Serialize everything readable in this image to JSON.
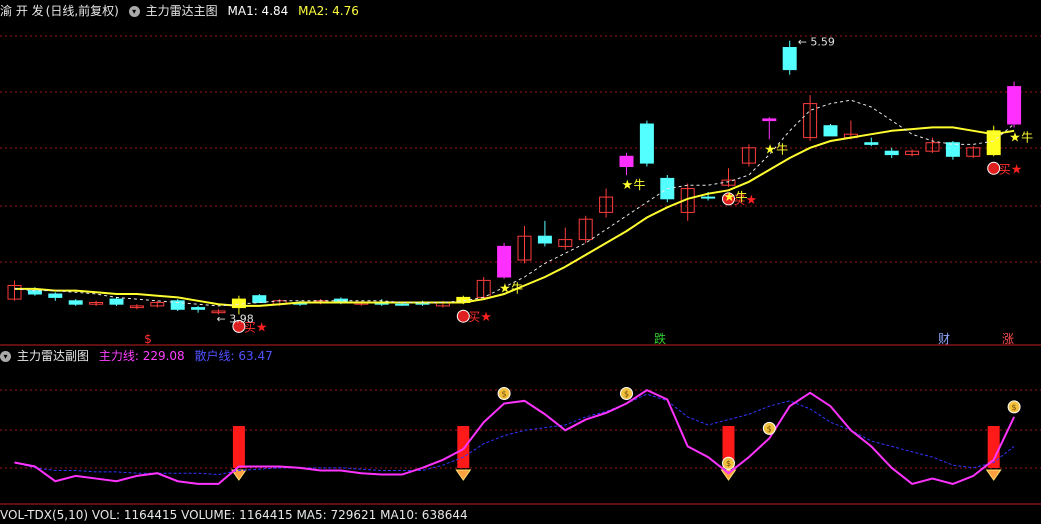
{
  "header": {
    "stock_name": "渝 开 发",
    "period_label": "(日线,前复权)",
    "indicator_name": "主力雷达主图",
    "ma1_label": "MA1: 4.84",
    "ma2_label": "MA2: 4.76"
  },
  "sub_header": {
    "indicator_name": "主力雷达副图",
    "main_line_label": "主力线: 229.08",
    "retail_line_label": "散户线: 63.47"
  },
  "vol_header": {
    "text": "VOL-TDX(5,10) VOL: 1164415 VOLUME: 1164415 MA5: 729621 MA10: 638644"
  },
  "annotations": {
    "high_label": "5.59",
    "low_label": "← 3.98",
    "buy_label": "买",
    "bull_label": "牛",
    "star": "★"
  },
  "event_markers": [
    {
      "label": "$",
      "color": "#ff3030"
    },
    {
      "label": "跌",
      "color": "#30d030"
    },
    {
      "label": "财",
      "color": "#8fa8ff"
    },
    {
      "label": "涨",
      "color": "#ff5050"
    }
  ],
  "colors": {
    "up_candle": "#ff3c3c",
    "down_candle": "#54ffff",
    "big_up_candle": "#ff30ff",
    "ma_line": "#ffff30",
    "grid": "#a01818",
    "main_line": "#ff33ff",
    "retail_line": "#3333ff",
    "signal_bar": "#ff1a1a"
  },
  "chart_data": {
    "type": "candlestick",
    "y_range": [
      3.9,
      5.7
    ],
    "candles": [
      {
        "o": 4.15,
        "h": 4.18,
        "l": 4.06,
        "c": 4.07,
        "ma": 4.13,
        "k": "up"
      },
      {
        "o": 4.12,
        "h": 4.14,
        "l": 4.09,
        "c": 4.1,
        "ma": 4.13,
        "k": "down"
      },
      {
        "o": 4.1,
        "h": 4.11,
        "l": 4.06,
        "c": 4.08,
        "ma": 4.12,
        "k": "down"
      },
      {
        "o": 4.06,
        "h": 4.07,
        "l": 4.03,
        "c": 4.04,
        "ma": 4.12,
        "k": "down"
      },
      {
        "o": 4.05,
        "h": 4.06,
        "l": 4.03,
        "c": 4.04,
        "ma": 4.11,
        "k": "up"
      },
      {
        "o": 4.07,
        "h": 4.08,
        "l": 4.03,
        "c": 4.04,
        "ma": 4.1,
        "k": "down"
      },
      {
        "o": 4.03,
        "h": 4.04,
        "l": 4.01,
        "c": 4.02,
        "ma": 4.1,
        "k": "up"
      },
      {
        "o": 4.05,
        "h": 4.06,
        "l": 4.02,
        "c": 4.03,
        "ma": 4.09,
        "k": "up"
      },
      {
        "o": 4.06,
        "h": 4.07,
        "l": 4.0,
        "c": 4.01,
        "ma": 4.08,
        "k": "down"
      },
      {
        "o": 4.02,
        "h": 4.03,
        "l": 3.99,
        "c": 4.01,
        "ma": 4.06,
        "k": "down"
      },
      {
        "o": 4.0,
        "h": 4.01,
        "l": 3.98,
        "c": 3.99,
        "ma": 4.04,
        "k": "up"
      },
      {
        "o": 4.02,
        "h": 4.09,
        "l": 3.98,
        "c": 4.07,
        "ma": 4.03,
        "k": "yellow"
      },
      {
        "o": 4.09,
        "h": 4.1,
        "l": 4.05,
        "c": 4.05,
        "ma": 4.03,
        "k": "down"
      },
      {
        "o": 4.04,
        "h": 4.07,
        "l": 4.03,
        "c": 4.06,
        "ma": 4.04,
        "k": "up"
      },
      {
        "o": 4.05,
        "h": 4.06,
        "l": 4.03,
        "c": 4.04,
        "ma": 4.05,
        "k": "down"
      },
      {
        "o": 4.06,
        "h": 4.07,
        "l": 4.04,
        "c": 4.05,
        "ma": 4.05,
        "k": "up"
      },
      {
        "o": 4.07,
        "h": 4.08,
        "l": 4.04,
        "c": 4.05,
        "ma": 4.05,
        "k": "down"
      },
      {
        "o": 4.04,
        "h": 4.06,
        "l": 4.03,
        "c": 4.05,
        "ma": 4.05,
        "k": "up"
      },
      {
        "o": 4.05,
        "h": 4.07,
        "l": 4.03,
        "c": 4.04,
        "ma": 4.05,
        "k": "down"
      },
      {
        "o": 4.04,
        "h": 4.05,
        "l": 4.03,
        "c": 4.04,
        "ma": 4.05,
        "k": "down"
      },
      {
        "o": 4.05,
        "h": 4.06,
        "l": 4.03,
        "c": 4.04,
        "ma": 4.05,
        "k": "down"
      },
      {
        "o": 4.03,
        "h": 4.06,
        "l": 4.02,
        "c": 4.05,
        "ma": 4.05,
        "k": "up"
      },
      {
        "o": 4.05,
        "h": 4.09,
        "l": 4.04,
        "c": 4.08,
        "ma": 4.05,
        "k": "yellow"
      },
      {
        "o": 4.08,
        "h": 4.2,
        "l": 4.07,
        "c": 4.18,
        "ma": 4.07,
        "k": "up"
      },
      {
        "o": 4.2,
        "h": 4.4,
        "l": 4.19,
        "c": 4.38,
        "ma": 4.1,
        "k": "magenta"
      },
      {
        "o": 4.3,
        "h": 4.5,
        "l": 4.28,
        "c": 4.44,
        "ma": 4.15,
        "k": "up"
      },
      {
        "o": 4.44,
        "h": 4.53,
        "l": 4.38,
        "c": 4.4,
        "ma": 4.2,
        "k": "down"
      },
      {
        "o": 4.38,
        "h": 4.49,
        "l": 4.36,
        "c": 4.42,
        "ma": 4.26,
        "k": "up"
      },
      {
        "o": 4.42,
        "h": 4.56,
        "l": 4.4,
        "c": 4.54,
        "ma": 4.33,
        "k": "up"
      },
      {
        "o": 4.58,
        "h": 4.72,
        "l": 4.55,
        "c": 4.67,
        "ma": 4.4,
        "k": "up"
      },
      {
        "o": 4.85,
        "h": 4.93,
        "l": 4.8,
        "c": 4.91,
        "ma": 4.47,
        "k": "magenta"
      },
      {
        "o": 5.1,
        "h": 5.12,
        "l": 4.85,
        "c": 4.87,
        "ma": 4.55,
        "k": "down"
      },
      {
        "o": 4.78,
        "h": 4.8,
        "l": 4.64,
        "c": 4.66,
        "ma": 4.61,
        "k": "down"
      },
      {
        "o": 4.58,
        "h": 4.75,
        "l": 4.53,
        "c": 4.72,
        "ma": 4.66,
        "k": "up"
      },
      {
        "o": 4.67,
        "h": 4.7,
        "l": 4.65,
        "c": 4.67,
        "ma": 4.69,
        "k": "down"
      },
      {
        "o": 4.77,
        "h": 4.84,
        "l": 4.73,
        "c": 4.74,
        "ma": 4.71,
        "k": "up"
      },
      {
        "o": 4.87,
        "h": 4.98,
        "l": 4.85,
        "c": 4.96,
        "ma": 4.76,
        "k": "up"
      },
      {
        "o": 5.12,
        "h": 5.14,
        "l": 5.01,
        "c": 5.13,
        "ma": 4.83,
        "k": "magenta"
      },
      {
        "o": 5.55,
        "h": 5.59,
        "l": 5.39,
        "c": 5.42,
        "ma": 4.9,
        "k": "down"
      },
      {
        "o": 5.02,
        "h": 5.27,
        "l": 5.0,
        "c": 5.22,
        "ma": 4.96,
        "k": "up"
      },
      {
        "o": 5.09,
        "h": 5.1,
        "l": 5.03,
        "c": 5.03,
        "ma": 5.0,
        "k": "down"
      },
      {
        "o": 5.02,
        "h": 5.12,
        "l": 5.01,
        "c": 5.04,
        "ma": 5.02,
        "k": "up"
      },
      {
        "o": 4.99,
        "h": 5.02,
        "l": 4.97,
        "c": 4.98,
        "ma": 5.04,
        "k": "down"
      },
      {
        "o": 4.94,
        "h": 4.96,
        "l": 4.9,
        "c": 4.92,
        "ma": 5.06,
        "k": "down"
      },
      {
        "o": 4.92,
        "h": 4.95,
        "l": 4.91,
        "c": 4.94,
        "ma": 5.07,
        "k": "up"
      },
      {
        "o": 4.94,
        "h": 5.02,
        "l": 4.93,
        "c": 4.99,
        "ma": 5.08,
        "k": "up"
      },
      {
        "o": 4.99,
        "h": 5.0,
        "l": 4.89,
        "c": 4.91,
        "ma": 5.08,
        "k": "down"
      },
      {
        "o": 4.91,
        "h": 4.97,
        "l": 4.9,
        "c": 4.96,
        "ma": 5.06,
        "k": "up"
      },
      {
        "o": 4.92,
        "h": 5.09,
        "l": 4.91,
        "c": 5.06,
        "ma": 5.04,
        "k": "yellow"
      },
      {
        "o": 5.1,
        "h": 5.35,
        "l": 5.08,
        "c": 5.32,
        "ma": 5.06,
        "k": "magenta"
      }
    ],
    "dashed_line": [
      4.13,
      4.12,
      4.12,
      4.11,
      4.1,
      4.08,
      4.07,
      4.06,
      4.05,
      4.04,
      4.03,
      4.04,
      4.05,
      4.06,
      4.06,
      4.06,
      4.06,
      4.06,
      4.06,
      4.05,
      4.05,
      4.05,
      4.06,
      4.08,
      4.14,
      4.2,
      4.28,
      4.34,
      4.4,
      4.48,
      4.56,
      4.64,
      4.72,
      4.74,
      4.74,
      4.76,
      4.8,
      4.92,
      5.06,
      5.18,
      5.22,
      5.24,
      5.2,
      5.12,
      5.04,
      5.0,
      4.98,
      4.98,
      5.0,
      5.1
    ],
    "subchart": {
      "y_range": [
        0,
        100
      ],
      "main_line": [
        28,
        25,
        14,
        18,
        16,
        14,
        18,
        20,
        14,
        12,
        12,
        25,
        25,
        25,
        24,
        22,
        22,
        20,
        19,
        19,
        24,
        30,
        38,
        58,
        72,
        74,
        64,
        52,
        60,
        65,
        72,
        82,
        75,
        40,
        32,
        20,
        32,
        46,
        70,
        80,
        70,
        52,
        40,
        24,
        12,
        16,
        12,
        18,
        30,
        62
      ],
      "retail_line": [
        28,
        24,
        22,
        22,
        21,
        21,
        20,
        20,
        20,
        20,
        19,
        22,
        23,
        24,
        24,
        24,
        24,
        23,
        22,
        22,
        22,
        26,
        32,
        42,
        48,
        52,
        54,
        56,
        62,
        66,
        72,
        79,
        74,
        62,
        56,
        60,
        64,
        70,
        74,
        68,
        58,
        52,
        44,
        40,
        36,
        32,
        26,
        24,
        28,
        40
      ],
      "signal_bars": [
        11,
        22,
        35,
        48
      ]
    }
  }
}
